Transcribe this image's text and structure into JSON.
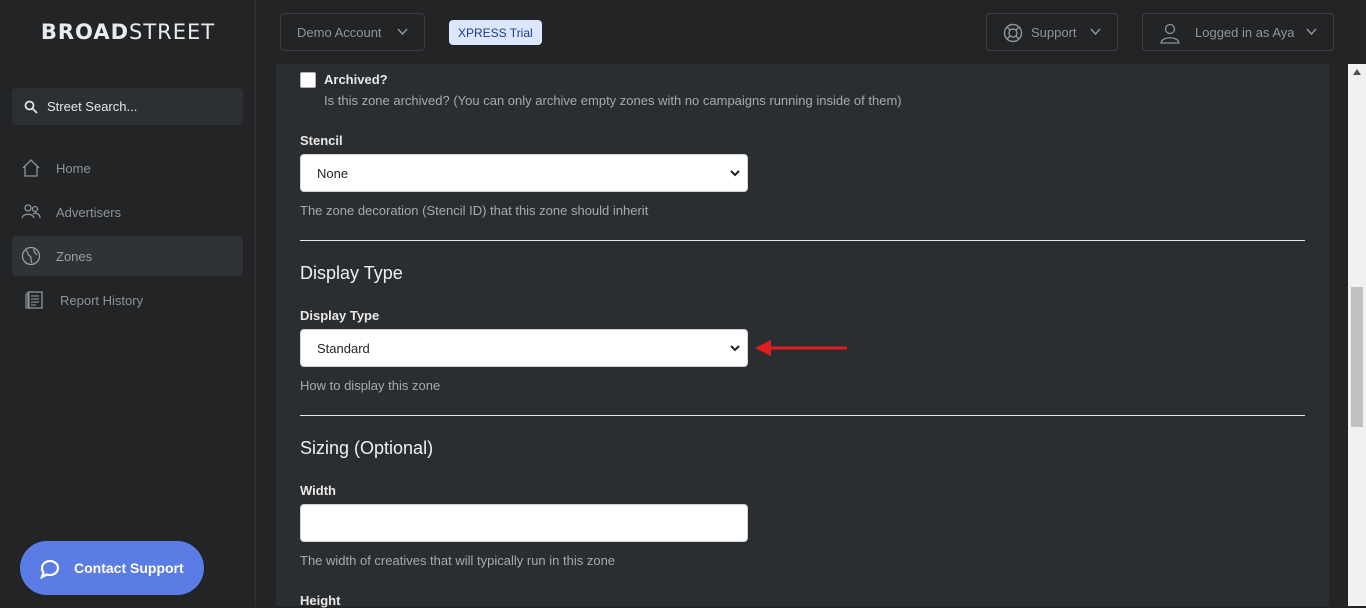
{
  "brand": {
    "logo_bold": "BROAD",
    "logo_thin": "STREET"
  },
  "search": {
    "placeholder": "Street Search..."
  },
  "nav": [
    {
      "label": "Home",
      "icon": "home-icon"
    },
    {
      "label": "Advertisers",
      "icon": "users-icon"
    },
    {
      "label": "Zones",
      "icon": "globe-icon",
      "active": true
    },
    {
      "label": "Report History",
      "icon": "report-icon"
    }
  ],
  "topbar": {
    "account": "Demo Account",
    "trial_badge": "XPRESS Trial",
    "support": "Support",
    "user": "Logged in as Aya"
  },
  "form": {
    "archived_label": "Archived?",
    "archived_help": "Is this zone archived? (You can only archive empty zones with no campaigns running inside of them)",
    "stencil_label": "Stencil",
    "stencil_value": "None",
    "stencil_help": "The zone decoration (Stencil ID) that this zone should inherit",
    "display_section": "Display Type",
    "display_label": "Display Type",
    "display_value": "Standard",
    "display_help": "How to display this zone",
    "sizing_section": "Sizing (Optional)",
    "width_label": "Width",
    "width_value": "",
    "width_help": "The width of creatives that will typically run in this zone",
    "height_label": "Height"
  },
  "contact_support": "Contact Support",
  "colors": {
    "accent": "#5b7be5",
    "annotation_arrow": "#e01e1e",
    "badge_bg": "#dce6ff"
  }
}
